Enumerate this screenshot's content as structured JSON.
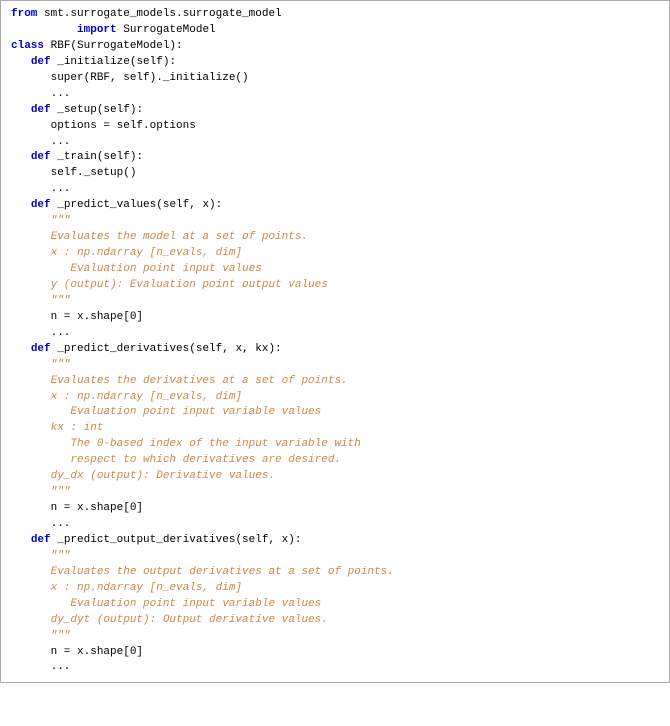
{
  "code": {
    "l1a": "from",
    "l1b": " smt.surrogate_models.surrogate_model",
    "l2a": "          ",
    "l2b": "import",
    "l2c": " SurrogateModel",
    "l3": "",
    "l4a": "class",
    "l4b": " RBF(SurrogateModel):",
    "l5a": "   ",
    "l5b": "def",
    "l5c": " _initialize(self):",
    "l6a": "      super(RBF, self)._initialize()",
    "l7a": "      ...",
    "l8": "",
    "l9a": "   ",
    "l9b": "def",
    "l9c": " _setup(self):",
    "l10a": "      options = self.options",
    "l11a": "      ...",
    "l12": "",
    "l13a": "   ",
    "l13b": "def",
    "l13c": " _train(self):",
    "l14a": "      self._setup()",
    "l15a": "      ...",
    "l16": "",
    "l17a": "   ",
    "l17b": "def",
    "l17c": " _predict_values(self, x):",
    "l18": "      \"\"\"",
    "l19": "      Evaluates the model at a set of points.",
    "l20": "      x : np.ndarray [n_evals, dim]",
    "l21": "         Evaluation point input values",
    "l22": "      y (output): Evaluation point output values",
    "l23": "      \"\"\"",
    "l24": "      n = x.shape[0]",
    "l25": "      ...",
    "l26": "",
    "l27a": "   ",
    "l27b": "def",
    "l27c": " _predict_derivatives(self, x, kx):",
    "l28": "      \"\"\"",
    "l29": "      Evaluates the derivatives at a set of points.",
    "l30": "      x : np.ndarray [n_evals, dim]",
    "l31": "         Evaluation point input variable values",
    "l32": "      kx : int",
    "l33": "         The 0-based index of the input variable with",
    "l34": "         respect to which derivatives are desired.",
    "l35": "      dy_dx (output): Derivative values.",
    "l36": "      \"\"\"",
    "l37": "      n = x.shape[0]",
    "l38": "      ...",
    "l39": "",
    "l40a": "   ",
    "l40b": "def",
    "l40c": " _predict_output_derivatives(self, x):",
    "l41": "      \"\"\"",
    "l42": "      Evaluates the output derivatives at a set of points.",
    "l43": "      x : np.ndarray [n_evals, dim]",
    "l44": "         Evaluation point input variable values",
    "l45": "      dy_dyt (output): Output derivative values.",
    "l46": "      \"\"\"",
    "l47": "      n = x.shape[0]",
    "l48": "      ..."
  }
}
